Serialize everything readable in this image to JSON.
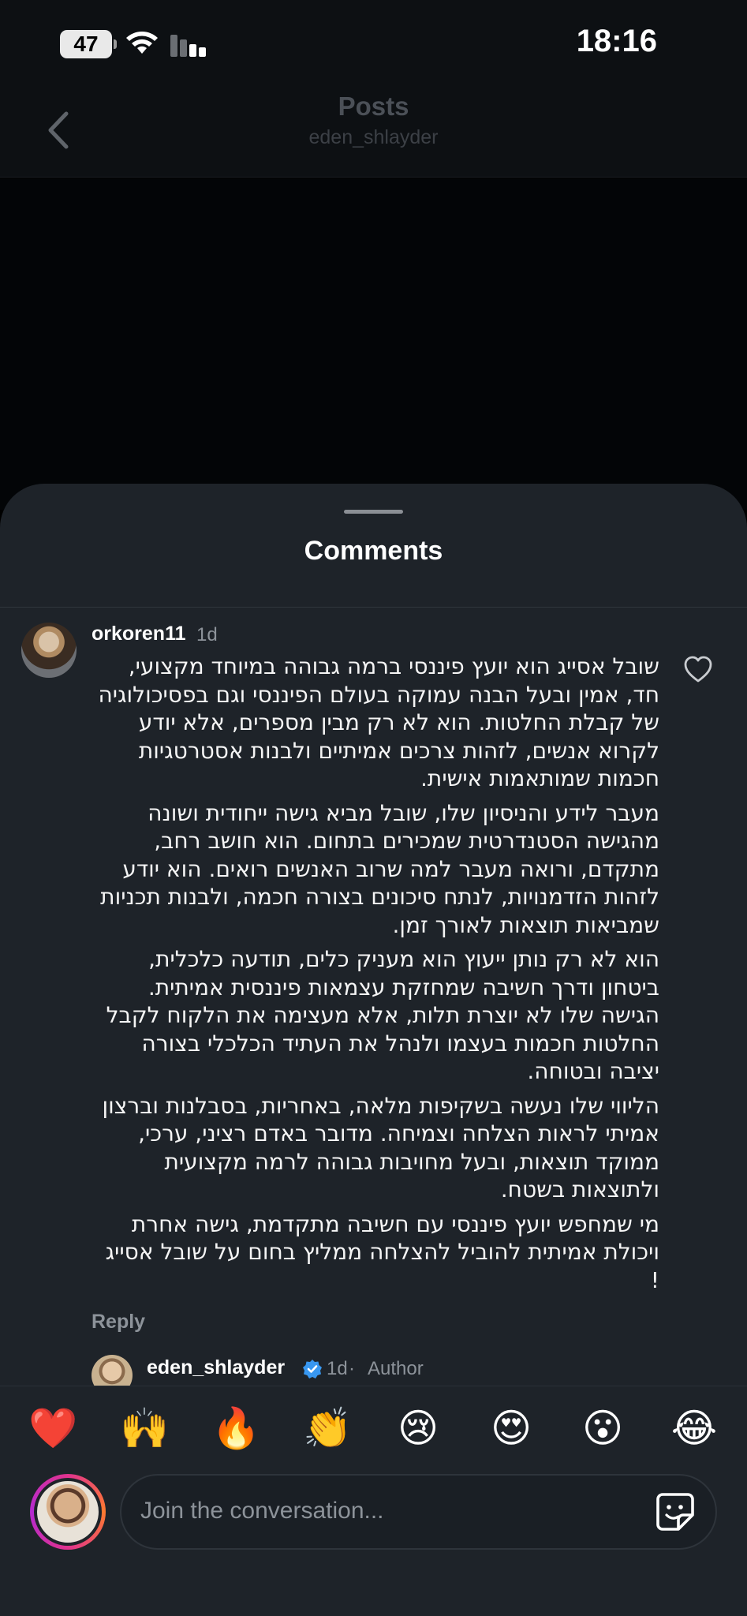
{
  "status_bar": {
    "battery": "47",
    "time": "18:16"
  },
  "header": {
    "title": "Posts",
    "subtitle": "eden_shlayder"
  },
  "sheet": {
    "title": "Comments"
  },
  "comment": {
    "username": "orkoren11",
    "time": "1d",
    "paragraphs": [
      "שובל אסייג הוא יועץ פיננסי ברמה גבוהה במיוחד מקצועי, חד, אמין ובעל הבנה עמוקה בעולם הפיננסי וגם בפסיכולוגיה של קבלת החלטות. הוא לא רק מבין מספרים, אלא יודע לקרוא אנשים, לזהות צרכים אמיתיים ולבנות אסטרטגיות חכמות שמותאמות אישית.",
      "מעבר לידע והניסיון שלו, שובל מביא גישה ייחודית ושונה מהגישה הסטנדרטית שמכירים בתחום. הוא חושב רחב, מתקדם, ורואה מעבר למה שרוב האנשים רואים. הוא יודע לזהות הזדמנויות, לנתח סיכונים בצורה חכמה, ולבנות תכניות שמביאות תוצאות לאורך זמן.",
      "הוא לא רק נותן ייעוץ הוא מעניק כלים, תודעה כלכלית, ביטחון ודרך חשיבה שמחזקת עצמאות פיננסית אמיתית. הגישה שלו לא יוצרת תלות, אלא מעצימה את הלקוח לקבל החלטות חכמות בעצמו ולנהל את העתיד הכלכלי בצורה יציבה ובטוחה.",
      "הליווי שלו נעשה בשקיפות מלאה, באחריות, בסבלנות וברצון אמיתי לראות הצלחה וצמיחה. מדובר באדם רציני, ערכי, ממוקד תוצאות, ובעל מחויבות גבוהה לרמה מקצועית ולתוצאות בשטח.",
      "מי שמחפש יועץ פיננסי עם חשיבה מתקדמת, גישה אחרת ויכולת אמיתית להוביל להצלחה ממליץ בחום על שובל אסייג !"
    ],
    "reply_label": "Reply"
  },
  "reply": {
    "username": "eden_shlayder",
    "time": "1d",
    "separator": "·",
    "author_label": "Author"
  },
  "emoji_bar": [
    {
      "name": "red-heart",
      "glyph": "❤️"
    },
    {
      "name": "raising-hands",
      "glyph": "🙌"
    },
    {
      "name": "fire",
      "glyph": "🔥"
    },
    {
      "name": "clapping-hands",
      "glyph": "👏"
    },
    {
      "name": "crying-face",
      "glyph": "😢"
    },
    {
      "name": "heart-eyes",
      "glyph": "😍"
    },
    {
      "name": "surprised-face",
      "glyph": "😮"
    },
    {
      "name": "tears-of-joy",
      "glyph": "😂"
    }
  ],
  "composer": {
    "placeholder": "Join the conversation..."
  },
  "colors": {
    "sheet_bg": "#1e2329",
    "verified": "#3897f0",
    "muted": "#8d939a"
  }
}
